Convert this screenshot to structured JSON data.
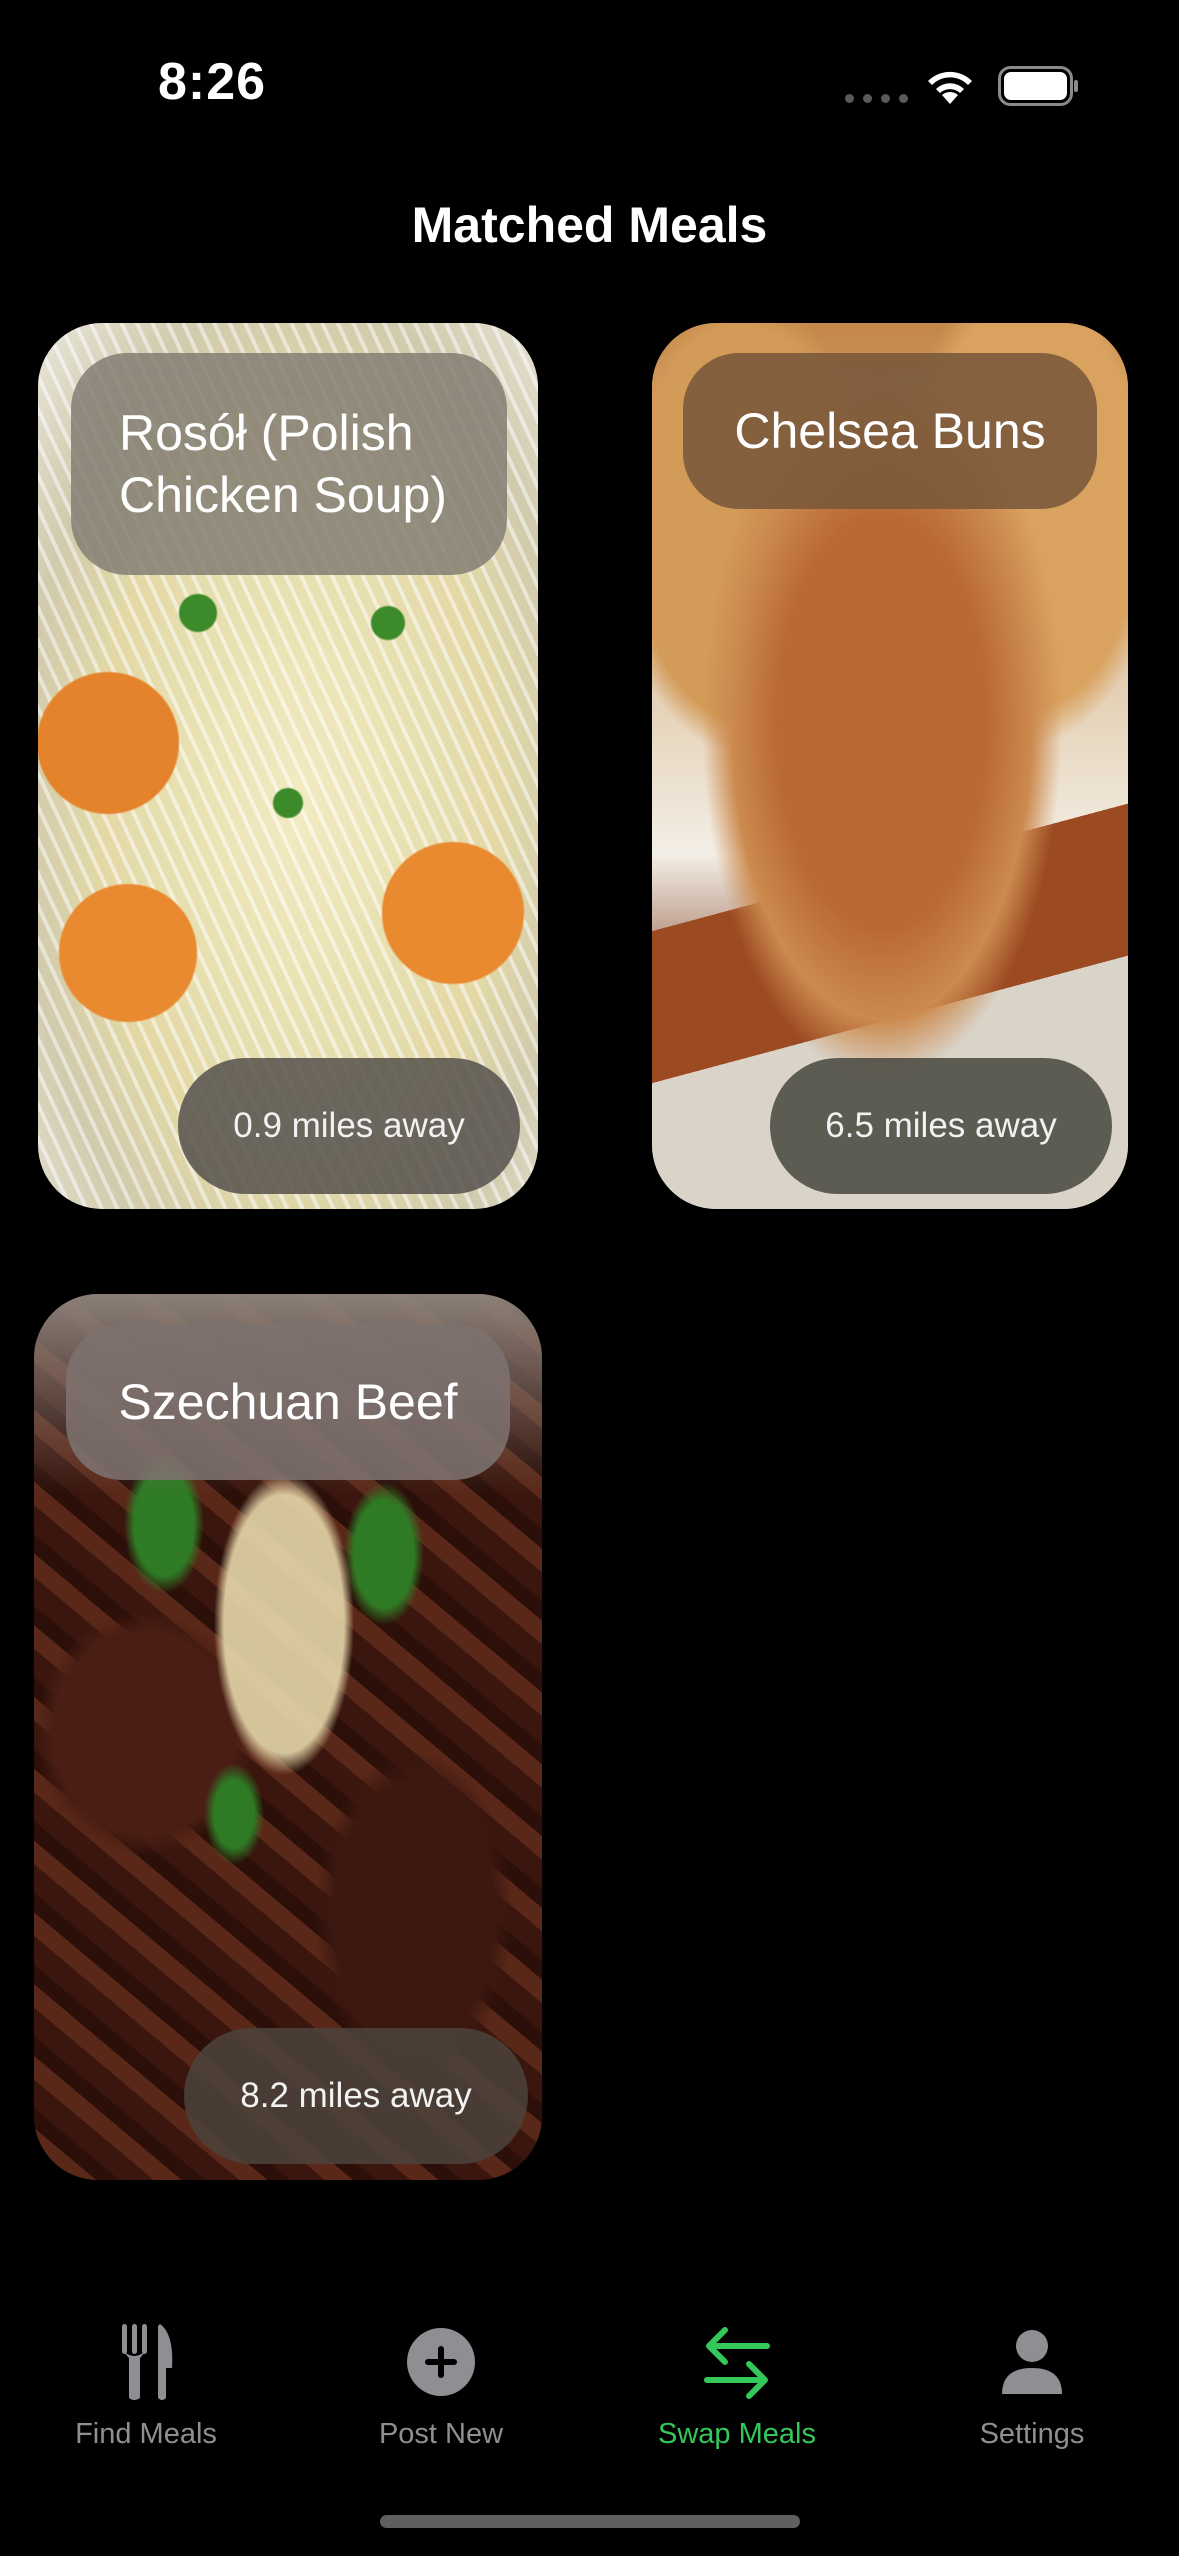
{
  "status_bar": {
    "time": "8:26"
  },
  "header": {
    "title": "Matched Meals"
  },
  "meals": [
    {
      "name": "Rosół (Polish Chicken Soup)",
      "distance": "0.9 miles away",
      "image_icon": "soup-photo"
    },
    {
      "name": "Chelsea Buns",
      "distance": "6.5 miles away",
      "image_icon": "buns-photo"
    },
    {
      "name": "Szechuan Beef",
      "distance": "8.2 miles away",
      "image_icon": "beef-photo"
    }
  ],
  "tab_bar": {
    "accent_color": "#34c759",
    "inactive_color": "#8e8e93",
    "tabs": [
      {
        "label": "Find Meals",
        "icon": "fork-knife-icon",
        "active": false
      },
      {
        "label": "Post New",
        "icon": "plus-circle-icon",
        "active": false
      },
      {
        "label": "Swap Meals",
        "icon": "swap-arrows-icon",
        "active": true
      },
      {
        "label": "Settings",
        "icon": "person-icon",
        "active": false
      }
    ]
  }
}
